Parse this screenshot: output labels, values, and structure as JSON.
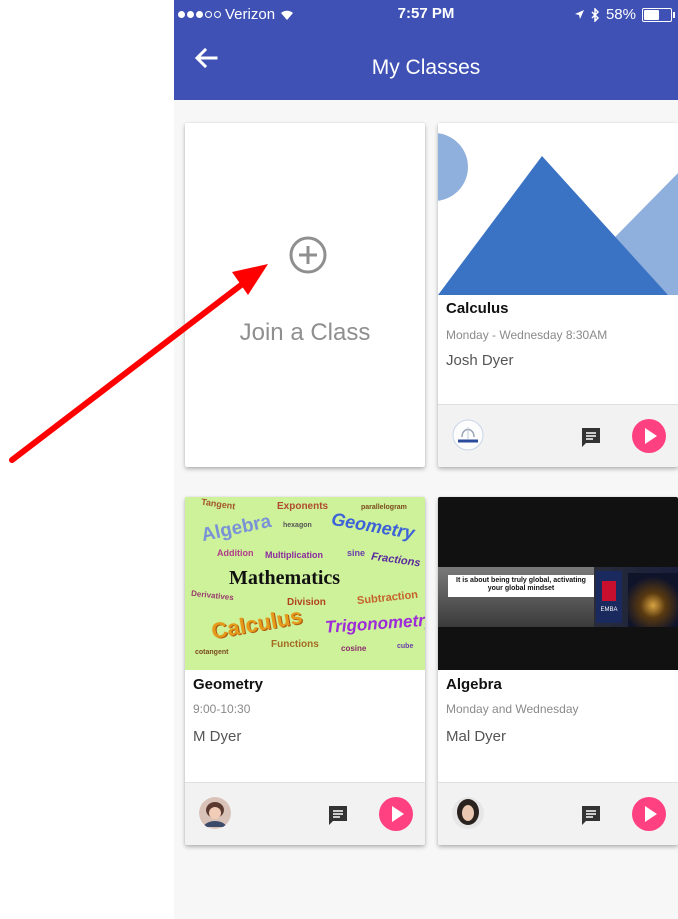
{
  "status_bar": {
    "carrier": "Verizon",
    "time": "7:57 PM",
    "battery": "58%",
    "battery_level": 0.58
  },
  "app_bar": {
    "title": "My Classes",
    "back_icon": "arrow-left-icon",
    "color": "#3f51b5"
  },
  "join_card": {
    "label": "Join a Class",
    "icon": "plus-circle-icon"
  },
  "classes": [
    {
      "name": "Calculus",
      "schedule": "Monday - Wednesday 8:30AM",
      "teacher": "Josh Dyer"
    },
    {
      "name": "Geometry",
      "schedule": "9:00-10:30",
      "teacher": "M Dyer",
      "cover_words": [
        "Tangent",
        "Exponents",
        "parallelogram",
        "Algebra",
        "hexagon",
        "Geometry",
        "Addition",
        "Multiplication",
        "sine",
        "Fractions",
        "Mathematics",
        "Derivatives",
        "Division",
        "Subtraction",
        "Calculus",
        "Trigonometry",
        "Functions",
        "cosine",
        "cotangent",
        "cube"
      ]
    },
    {
      "name": "Algebra",
      "schedule": "Monday and Wednesday",
      "teacher": "Mal Dyer",
      "cover_caption": "It is about being truly global, activating your global mindset",
      "cover_logo": "EMBA"
    }
  ],
  "colors": {
    "accent": "#ff4081",
    "annotation_arrow": "#ff0000"
  }
}
